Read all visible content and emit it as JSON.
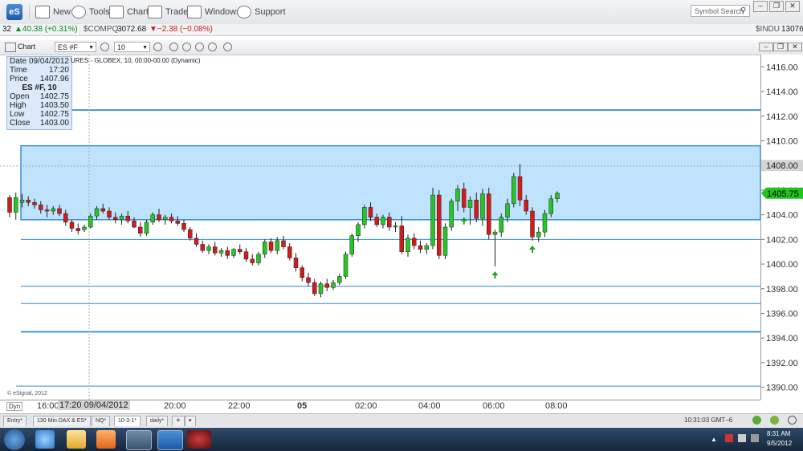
{
  "toolbar": {
    "logo": "eS",
    "buttons": [
      {
        "label": "New",
        "icon": "new-window-icon"
      },
      {
        "label": "Tools",
        "icon": "tools-icon"
      },
      {
        "label": "Chart",
        "icon": "chart-icon"
      },
      {
        "label": "Trade",
        "icon": "trade-icon"
      },
      {
        "label": "Windows",
        "icon": "windows-icon"
      },
      {
        "label": "Support",
        "icon": "support-icon"
      }
    ],
    "search_placeholder": "Symbol Search"
  },
  "ticker": {
    "prefix": "32",
    "item1_change": "▲40.38 (+0.31%)",
    "item2_symbol": "$COMPQ",
    "item2_last": "3072.68",
    "item2_change": "▼−2.38 (−0.08%)",
    "item3_symbol": "$INDU",
    "item3_last": "13076"
  },
  "chart_window": {
    "title": "Chart",
    "symbol": "ES #F",
    "interval": "10",
    "study_title": "URES - GLOBEX, 10, 00:00-00:00 (Dynamic)"
  },
  "databox": {
    "rows": [
      {
        "label": "Date",
        "value": "09/04/2012"
      },
      {
        "label": "Time",
        "value": "17:20"
      },
      {
        "label": "Price",
        "value": "1407.96"
      }
    ],
    "header": "ES #F, 10",
    "ohlc": [
      {
        "label": "Open",
        "value": "1402.75"
      },
      {
        "label": "High",
        "value": "1403.50"
      },
      {
        "label": "Low",
        "value": "1402.75"
      },
      {
        "label": "Close",
        "value": "1403.00"
      }
    ]
  },
  "copyright": "© eSignal, 2012",
  "time_axis": {
    "dyn": "Dyn",
    "left_label": "16:00",
    "cursor_label": "17:20 09/04/2012",
    "labels": [
      "20:00",
      "22:00",
      "05",
      "02:00",
      "04:00",
      "06:00",
      "08:00"
    ]
  },
  "tabs": [
    "Entry*",
    "130 Min DAX & ES*",
    "NQ*",
    "10-3-1*",
    "daily*"
  ],
  "clock": "10:31:03 GMT−6",
  "tray": {
    "time": "8:31 AM",
    "date": "9/5/2012"
  },
  "chart_data": {
    "type": "candlestick",
    "y_ticks": [
      "1416.00",
      "1414.00",
      "1412.00",
      "1410.00",
      "1408.00",
      "1406.00",
      "1404.00",
      "1402.00",
      "1400.00",
      "1398.00",
      "1396.00",
      "1394.00",
      "1392.00",
      "1390.00"
    ],
    "ylim": [
      1389,
      1417
    ],
    "crosshair_price": "1408.00",
    "last_price": "1405.75",
    "zone": [
      1403.6,
      1409.6
    ],
    "levels": [
      1412.5,
      1402.0,
      1398.2,
      1396.8,
      1394.5,
      1390.1
    ],
    "bar_count": 90,
    "candles": [
      [
        1405.4,
        1405.6,
        1403.8,
        1404.2
      ],
      [
        1404.2,
        1405.8,
        1403.6,
        1405.4
      ],
      [
        1405.0,
        1405.7,
        1404.6,
        1405.2
      ],
      [
        1405.2,
        1405.5,
        1404.7,
        1405.0
      ],
      [
        1405.0,
        1405.3,
        1404.5,
        1404.8
      ],
      [
        1404.8,
        1405.1,
        1404.1,
        1404.4
      ],
      [
        1404.4,
        1404.8,
        1403.8,
        1404.3
      ],
      [
        1404.3,
        1404.7,
        1404.0,
        1404.5
      ],
      [
        1404.5,
        1404.8,
        1403.9,
        1404.1
      ],
      [
        1404.1,
        1404.4,
        1403.1,
        1403.4
      ],
      [
        1403.4,
        1403.6,
        1402.6,
        1402.9
      ],
      [
        1402.9,
        1403.3,
        1402.4,
        1402.7
      ],
      [
        1402.8,
        1403.2,
        1402.6,
        1403.0
      ],
      [
        1403.0,
        1404.1,
        1402.9,
        1403.9
      ],
      [
        1403.9,
        1404.7,
        1403.6,
        1404.5
      ],
      [
        1404.5,
        1404.9,
        1404.1,
        1404.3
      ],
      [
        1404.3,
        1404.6,
        1403.6,
        1403.8
      ],
      [
        1403.8,
        1404.2,
        1403.3,
        1403.6
      ],
      [
        1403.6,
        1404.1,
        1403.2,
        1403.9
      ],
      [
        1403.9,
        1404.3,
        1403.3,
        1403.5
      ],
      [
        1403.5,
        1403.8,
        1402.9,
        1403.0
      ],
      [
        1403.0,
        1403.4,
        1402.2,
        1402.5
      ],
      [
        1402.5,
        1403.6,
        1402.3,
        1403.4
      ],
      [
        1403.4,
        1404.2,
        1403.2,
        1404.0
      ],
      [
        1404.0,
        1404.5,
        1403.4,
        1403.6
      ],
      [
        1403.6,
        1404.0,
        1403.2,
        1403.8
      ],
      [
        1403.8,
        1404.1,
        1403.3,
        1403.5
      ],
      [
        1403.5,
        1403.9,
        1403.1,
        1403.3
      ],
      [
        1403.3,
        1403.6,
        1402.6,
        1402.8
      ],
      [
        1402.8,
        1403.0,
        1401.9,
        1402.1
      ],
      [
        1402.1,
        1402.5,
        1401.4,
        1401.6
      ],
      [
        1401.6,
        1401.9,
        1400.9,
        1401.1
      ],
      [
        1401.1,
        1401.6,
        1400.8,
        1401.4
      ],
      [
        1401.4,
        1401.8,
        1400.7,
        1400.9
      ],
      [
        1400.9,
        1401.3,
        1400.6,
        1401.1
      ],
      [
        1401.1,
        1401.4,
        1400.4,
        1400.7
      ],
      [
        1400.7,
        1401.3,
        1400.5,
        1401.2
      ],
      [
        1401.2,
        1401.6,
        1400.8,
        1401.0
      ],
      [
        1401.0,
        1401.3,
        1400.2,
        1400.4
      ],
      [
        1400.4,
        1400.8,
        1399.9,
        1400.1
      ],
      [
        1400.1,
        1401.0,
        1399.9,
        1400.8
      ],
      [
        1400.8,
        1402.0,
        1400.5,
        1401.8
      ],
      [
        1401.8,
        1402.1,
        1400.9,
        1401.1
      ],
      [
        1401.1,
        1402.2,
        1400.8,
        1401.9
      ],
      [
        1401.9,
        1402.3,
        1401.2,
        1401.4
      ],
      [
        1401.4,
        1401.7,
        1400.3,
        1400.5
      ],
      [
        1400.5,
        1400.9,
        1399.4,
        1399.7
      ],
      [
        1399.7,
        1399.9,
        1398.6,
        1398.9
      ],
      [
        1398.9,
        1399.3,
        1398.2,
        1398.5
      ],
      [
        1398.5,
        1398.8,
        1397.4,
        1397.6
      ],
      [
        1397.6,
        1398.6,
        1397.3,
        1398.4
      ],
      [
        1398.4,
        1398.8,
        1397.8,
        1398.1
      ],
      [
        1398.1,
        1398.7,
        1397.9,
        1398.5
      ],
      [
        1398.5,
        1399.2,
        1398.3,
        1399.0
      ],
      [
        1399.0,
        1401.0,
        1398.8,
        1400.8
      ],
      [
        1400.8,
        1402.5,
        1400.6,
        1402.3
      ],
      [
        1402.3,
        1403.4,
        1401.8,
        1403.2
      ],
      [
        1403.2,
        1404.8,
        1402.9,
        1404.6
      ],
      [
        1404.6,
        1405.0,
        1403.5,
        1403.8
      ],
      [
        1403.8,
        1404.1,
        1403.0,
        1403.2
      ],
      [
        1403.2,
        1404.0,
        1402.9,
        1403.8
      ],
      [
        1403.8,
        1404.2,
        1402.7,
        1403.0
      ],
      [
        1403.0,
        1403.4,
        1402.6,
        1403.1
      ],
      [
        1403.1,
        1403.9,
        1400.8,
        1401.0
      ],
      [
        1401.0,
        1402.4,
        1400.6,
        1402.1
      ],
      [
        1402.1,
        1402.5,
        1401.2,
        1401.5
      ],
      [
        1401.5,
        1401.9,
        1400.9,
        1401.2
      ],
      [
        1401.2,
        1401.7,
        1400.8,
        1401.5
      ],
      [
        1401.5,
        1406.2,
        1401.2,
        1405.6
      ],
      [
        1405.6,
        1406.0,
        1400.4,
        1400.7
      ],
      [
        1400.7,
        1403.3,
        1400.4,
        1403.0
      ],
      [
        1403.0,
        1405.3,
        1402.7,
        1405.1
      ],
      [
        1405.1,
        1406.4,
        1404.3,
        1406.1
      ],
      [
        1406.1,
        1406.6,
        1404.2,
        1404.6
      ],
      [
        1404.6,
        1405.5,
        1403.2,
        1405.2
      ],
      [
        1405.2,
        1405.8,
        1403.4,
        1403.7
      ],
      [
        1403.7,
        1406.1,
        1403.1,
        1405.7
      ],
      [
        1405.7,
        1406.2,
        1402.0,
        1402.4
      ],
      [
        1402.4,
        1402.8,
        1399.8,
        1402.6
      ],
      [
        1402.6,
        1404.1,
        1402.2,
        1403.8
      ],
      [
        1403.8,
        1405.3,
        1403.4,
        1404.9
      ],
      [
        1404.9,
        1407.4,
        1404.6,
        1407.1
      ],
      [
        1407.1,
        1408.1,
        1404.7,
        1405.2
      ],
      [
        1405.2,
        1405.6,
        1404.0,
        1404.3
      ],
      [
        1404.3,
        1404.6,
        1401.9,
        1402.2
      ],
      [
        1402.2,
        1403.0,
        1401.8,
        1402.6
      ],
      [
        1402.6,
        1404.4,
        1402.2,
        1404.1
      ],
      [
        1404.1,
        1405.6,
        1403.8,
        1405.3
      ],
      [
        1405.3,
        1405.9,
        1405.0,
        1405.75
      ]
    ],
    "arrows_at_bar": [
      73,
      78,
      84
    ]
  }
}
